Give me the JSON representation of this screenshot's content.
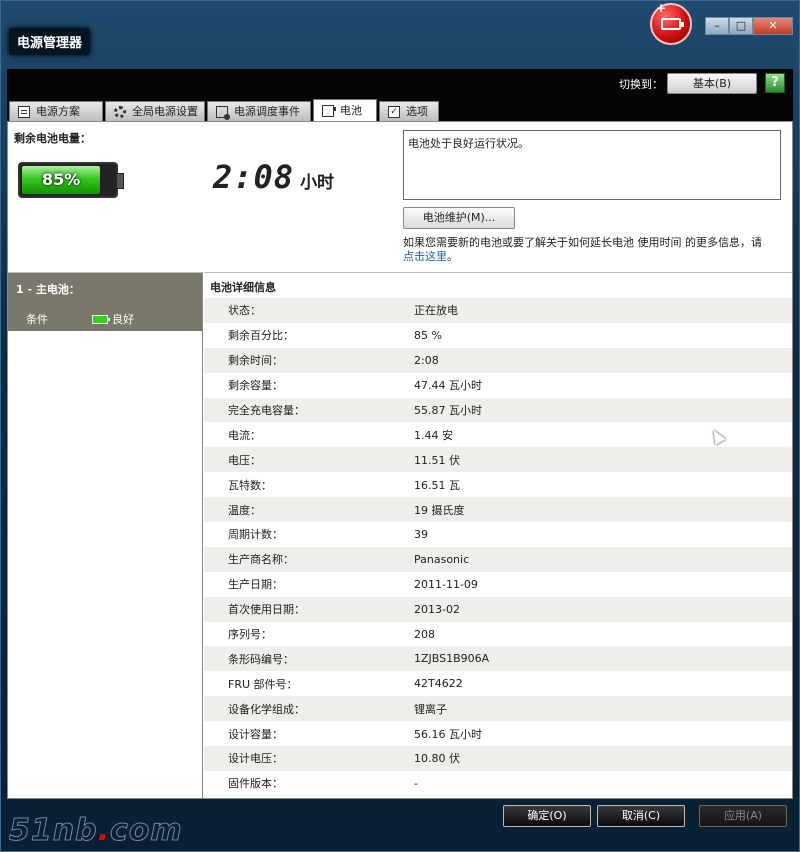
{
  "window": {
    "title": "电源管理器",
    "close_glyph": "✕",
    "max_glyph": "□",
    "min_glyph": "–"
  },
  "toolbar": {
    "switch_label": "切换到：",
    "switch_button": "基本(B)",
    "help_glyph": "?"
  },
  "tabs": [
    {
      "label": "电源方案",
      "icon": "document-icon"
    },
    {
      "label": "全局电源设置",
      "icon": "gear-icon"
    },
    {
      "label": "电源调度事件",
      "icon": "schedule-icon"
    },
    {
      "label": "电池",
      "icon": "battery-icon",
      "active": true
    },
    {
      "label": "选项",
      "icon": "checkbox-icon"
    }
  ],
  "battery": {
    "remaining_label": "剩余电池电量：",
    "percent_text": "85%",
    "percent_value": 85,
    "time": "2:08",
    "time_unit": "小时",
    "status_message": "电池处于良好运行状况。",
    "maintenance_button": "电池维护(M)...",
    "info_text": "如果您需要新的电池或要了解关于如何延长电池 使用时间 的更多信息，请",
    "info_link": "点击这里",
    "info_suffix": "。"
  },
  "battery_list": {
    "title": "1 - 主电池：",
    "condition_label": "条件",
    "condition_value": "良好"
  },
  "details": {
    "header": "电池详细信息",
    "rows": [
      {
        "key": "状态：",
        "value": "正在放电"
      },
      {
        "key": "剩余百分比：",
        "value": "85 %"
      },
      {
        "key": "剩余时间：",
        "value": "2:08"
      },
      {
        "key": "剩余容量：",
        "value": "47.44 瓦小时"
      },
      {
        "key": "完全充电容量：",
        "value": "55.87 瓦小时"
      },
      {
        "key": "电流：",
        "value": "1.44 安"
      },
      {
        "key": "电压：",
        "value": "11.51 伏"
      },
      {
        "key": "瓦特数：",
        "value": "16.51 瓦"
      },
      {
        "key": "温度：",
        "value": "19 摄氏度"
      },
      {
        "key": "周期计数：",
        "value": "39"
      },
      {
        "key": "生产商名称：",
        "value": "Panasonic"
      },
      {
        "key": "生产日期：",
        "value": "2011-11-09"
      },
      {
        "key": "首次使用日期：",
        "value": "2013-02"
      },
      {
        "key": "序列号：",
        "value": "208"
      },
      {
        "key": "条形码编号：",
        "value": "1ZJBS1B906A"
      },
      {
        "key": "FRU 部件号：",
        "value": "42T4622"
      },
      {
        "key": "设备化学组成：",
        "value": "锂离子"
      },
      {
        "key": "设计容量：",
        "value": "56.16 瓦小时"
      },
      {
        "key": "设计电压：",
        "value": "10.80 伏"
      },
      {
        "key": "固件版本：",
        "value": "-"
      }
    ]
  },
  "footer": {
    "ok": "确定(O)",
    "cancel": "取消(C)",
    "apply": "应用(A)",
    "watermark_pre": "51nb",
    "watermark_dot": ".",
    "watermark_post": "com"
  },
  "colors": {
    "battery_green": "#35c820",
    "frame_blue": "#0f2b45",
    "link": "#1a5fb4"
  }
}
